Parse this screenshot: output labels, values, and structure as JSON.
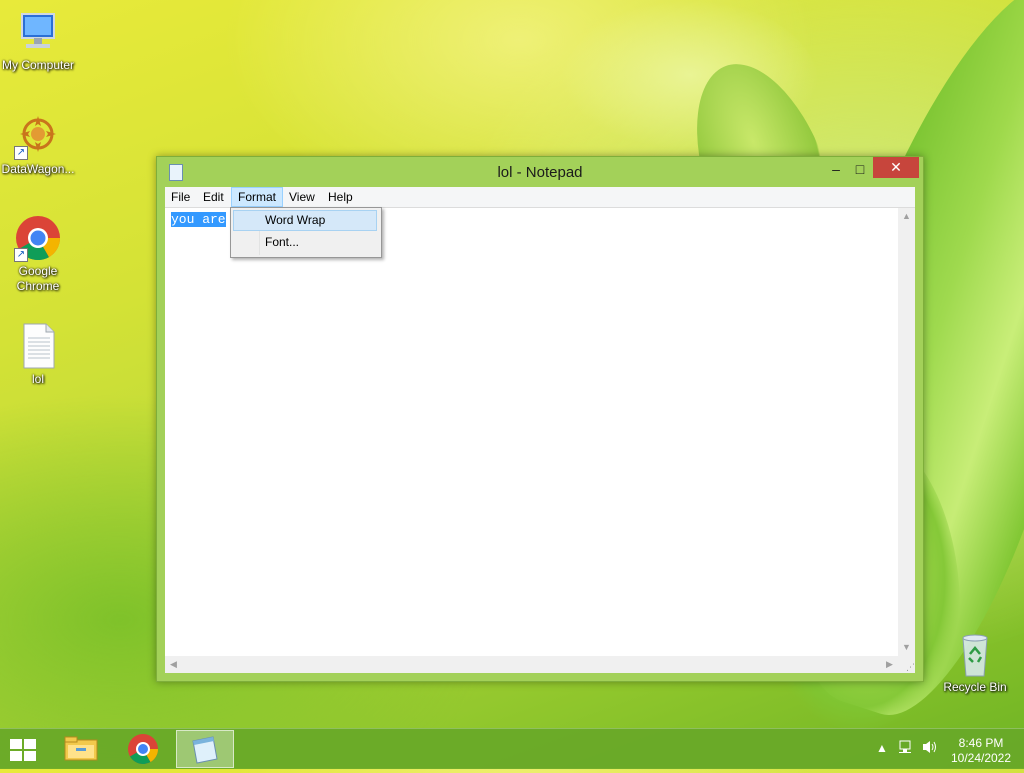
{
  "desktop": {
    "icons": [
      {
        "label": "My Computer",
        "icon": "computer-icon"
      },
      {
        "label": "DataWagon...",
        "icon": "datawagon-icon"
      },
      {
        "label": "Google Chrome",
        "icon": "chrome-icon"
      },
      {
        "label": "lol",
        "icon": "text-file-icon"
      },
      {
        "label": "Recycle Bin",
        "icon": "recycle-bin-icon"
      }
    ]
  },
  "window": {
    "title": "lol - Notepad",
    "controls": {
      "minimize": "–",
      "maximize": "□",
      "close": "✕"
    }
  },
  "menubar": {
    "items": [
      "File",
      "Edit",
      "Format",
      "View",
      "Help"
    ],
    "active": "Format"
  },
  "format_menu": {
    "items": [
      "Word Wrap",
      "Font..."
    ],
    "hovered": "Word Wrap"
  },
  "editor": {
    "selected_text": "you are"
  },
  "taskbar": {
    "apps": [
      "file-explorer-icon",
      "chrome-icon",
      "notepad-icon"
    ],
    "active_app": "notepad-icon"
  },
  "clock": {
    "time": "8:46 PM",
    "date": "10/24/2022"
  },
  "colors": {
    "window_frame": "#a3d159",
    "close_button": "#c7453c",
    "selection": "#3399ff",
    "taskbar": "#68a828"
  }
}
